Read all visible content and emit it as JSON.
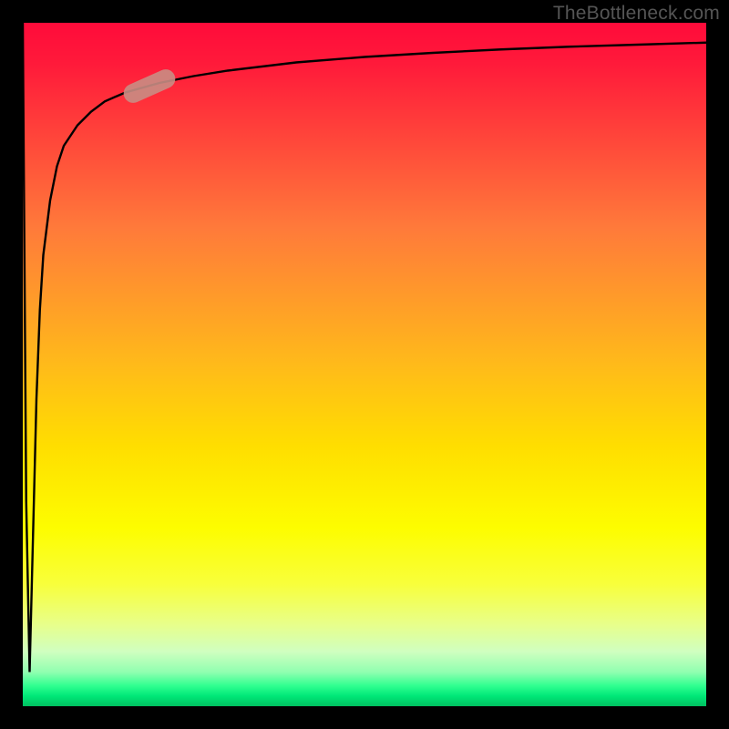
{
  "attribution": "TheBottleneck.com",
  "chart_data": {
    "type": "line",
    "title": "",
    "xlabel": "",
    "ylabel": "",
    "xlim": [
      0,
      100
    ],
    "ylim": [
      0,
      100
    ],
    "series": [
      {
        "name": "curve",
        "x": [
          0,
          0.5,
          1.0,
          1.5,
          2.0,
          2.5,
          3,
          4,
          5,
          6,
          8,
          10,
          12,
          15,
          20,
          25,
          30,
          40,
          50,
          60,
          70,
          80,
          90,
          100
        ],
        "values": [
          100,
          30,
          5,
          25,
          45,
          58,
          66,
          74,
          79,
          82,
          85,
          87,
          88.5,
          89.8,
          91.2,
          92.2,
          93.0,
          94.2,
          95.0,
          95.6,
          96.1,
          96.5,
          96.8,
          97.1
        ]
      }
    ],
    "highlight_segment": {
      "x_start": 15,
      "x_end": 22,
      "angle_deg": -24
    },
    "background_gradient": {
      "top": "#ff0b3a",
      "mid": "#ffde00",
      "bottom": "#00c060"
    }
  }
}
